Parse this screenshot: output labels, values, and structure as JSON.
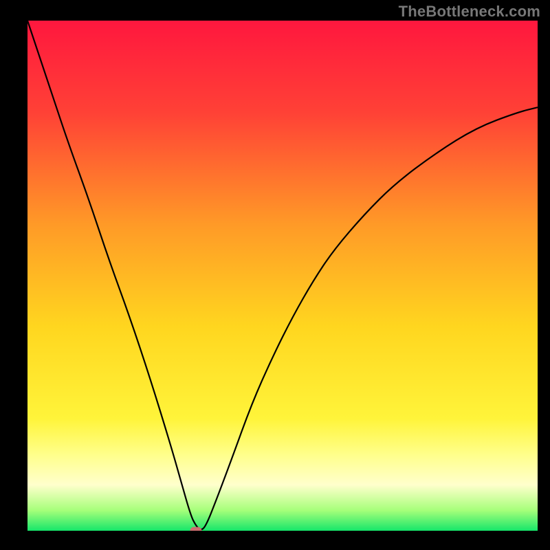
{
  "watermark": "TheBottleneck.com",
  "gradient": {
    "stops": [
      {
        "pct": 0,
        "color": "#ff173e"
      },
      {
        "pct": 18,
        "color": "#ff4136"
      },
      {
        "pct": 40,
        "color": "#ff9a27"
      },
      {
        "pct": 60,
        "color": "#ffd61f"
      },
      {
        "pct": 78,
        "color": "#fff43a"
      },
      {
        "pct": 85,
        "color": "#ffff8a"
      },
      {
        "pct": 91,
        "color": "#ffffcc"
      },
      {
        "pct": 96,
        "color": "#a6ff7a"
      },
      {
        "pct": 100,
        "color": "#16e66a"
      }
    ]
  },
  "marker": {
    "color": "#cc6d6f"
  },
  "curve": {
    "stroke": "#000000",
    "width": 2.2
  },
  "chart_data": {
    "type": "line",
    "title": "",
    "xlabel": "",
    "ylabel": "",
    "xlim": [
      0,
      100
    ],
    "ylim": [
      0,
      100
    ],
    "grid": false,
    "legend_position": "none",
    "series": [
      {
        "name": "bottleneck-curve",
        "x": [
          0,
          2,
          5,
          8,
          12,
          16,
          20,
          24,
          28,
          30,
          32,
          33,
          34,
          35,
          37,
          40,
          44,
          48,
          52,
          56,
          60,
          66,
          72,
          80,
          88,
          96,
          100
        ],
        "y": [
          100,
          94,
          85,
          76,
          65,
          53,
          42,
          30,
          17,
          10,
          3,
          1,
          0,
          1,
          6,
          14,
          25,
          34,
          42,
          49,
          55,
          62,
          68,
          74,
          79,
          82,
          83
        ]
      }
    ],
    "annotations": [
      {
        "type": "marker",
        "x": 33,
        "y": 0,
        "label": "optimal-point"
      }
    ]
  }
}
